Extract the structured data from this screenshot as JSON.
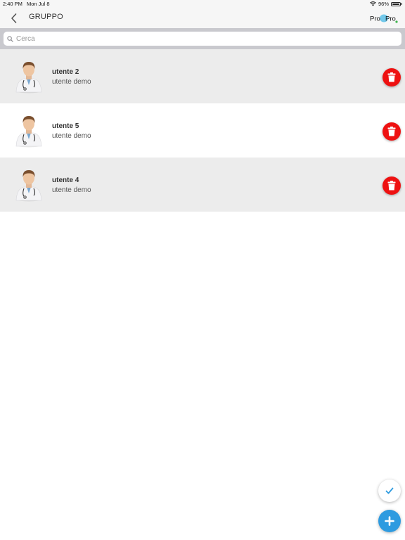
{
  "status_bar": {
    "time": "2:40 PM",
    "date": "Mon Jul 8",
    "battery": "96%"
  },
  "header": {
    "title": "GRUPPO",
    "logo_left": "Pro",
    "logo_right": "Pro"
  },
  "search": {
    "placeholder": "Cerca",
    "value": ""
  },
  "users": [
    {
      "name": "utente 2",
      "description": "utente demo"
    },
    {
      "name": "utente 5",
      "description": "utente demo"
    },
    {
      "name": "utente 4",
      "description": "utente demo"
    }
  ],
  "colors": {
    "delete": "#ee1111",
    "add": "#2e9be0",
    "check": "#2e9be0",
    "row_shade": "#ececec"
  },
  "icons": {
    "back": "chevron-left-icon",
    "search": "search-icon",
    "delete": "trash-icon",
    "check": "check-icon",
    "add": "plus-icon",
    "avatar": "doctor-avatar-icon"
  }
}
